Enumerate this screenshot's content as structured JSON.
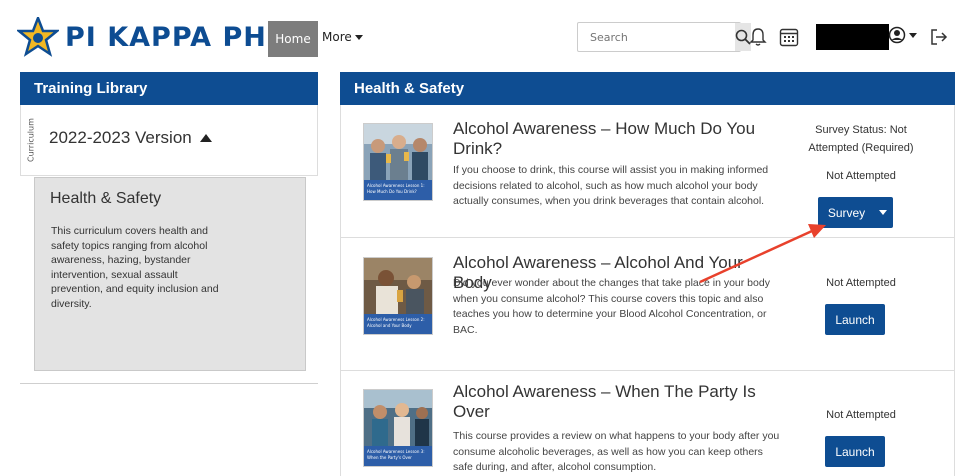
{
  "header": {
    "logo_text": "PI KAPPA PHI",
    "nav": {
      "home": "Home",
      "more": "More"
    },
    "search": {
      "placeholder": "Search"
    },
    "icons": [
      "search-icon",
      "bell-icon",
      "calendar-icon",
      "user-icon",
      "logout-icon"
    ],
    "brand_color": "#0e4d92"
  },
  "sidebar": {
    "title": "Training Library",
    "tab_label": "Curriculum",
    "version": "2022-2023 Version",
    "curriculum": {
      "title": "Health & Safety",
      "description": "This curriculum covers health and safety topics ranging from alcohol awareness, hazing, bystander intervention, sexual assault prevention, and equity inclusion and diversity."
    }
  },
  "main": {
    "title": "Health & Safety",
    "courses": [
      {
        "title": "Alcohol Awareness – How Much Do You Drink?",
        "description": "If you choose to drink, this course will assist you in making informed decisions related to alcohol, such as how much alcohol your body actually consumes, when you drink beverages that contain alcohol.",
        "thumb_caption": "Alcohol Awareness Lesson 1: How Much Do You Drink?",
        "survey_status": "Survey Status: Not Attempted (Required)",
        "status": "Not Attempted",
        "button": "Survey"
      },
      {
        "title": "Alcohol Awareness – Alcohol And Your Body",
        "description": "Did you ever wonder about the changes that take place in your body when you consume alcohol? This course covers this topic and also teaches you how to determine your Blood Alcohol Concentration, or BAC.",
        "thumb_caption": "Alcohol Awareness Lesson 2: Alcohol and Your Body",
        "status": "Not Attempted",
        "button": "Launch"
      },
      {
        "title": "Alcohol Awareness – When The Party Is Over",
        "description": "This course provides a review on what happens to your body after you consume alcoholic beverages, as well as how you can keep others safe during, and after, alcohol consumption.",
        "thumb_caption": "Alcohol Awareness Lesson 3: When the Party's Over",
        "status": "Not Attempted",
        "button": "Launch"
      }
    ]
  },
  "annotation_color": "#e8412c"
}
